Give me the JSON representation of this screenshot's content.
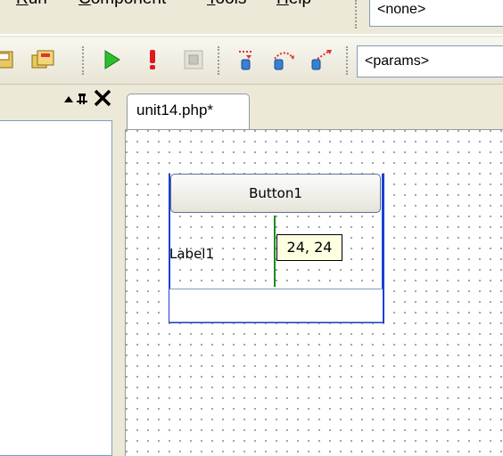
{
  "menu": {
    "items": [
      "Run",
      "Component",
      "Tools",
      "Help"
    ]
  },
  "toolbar": {
    "target_combo": "<none>",
    "params_combo": "<params>",
    "icons": [
      "save-icon",
      "save-all-icon",
      "run-icon",
      "debug-icon",
      "stop-icon",
      "step-into-icon",
      "step-over-icon",
      "step-out-icon"
    ]
  },
  "left_panel": {
    "pin_glyph": "▲ ⊓",
    "close_glyph": "✕"
  },
  "editor": {
    "tab_label": "unit14.php*"
  },
  "form": {
    "button_caption": "Button1",
    "label_caption": "Label1",
    "coordinate_tooltip": "24, 24"
  },
  "colors": {
    "selection": "#1A3FD8",
    "guide": "#1E8A1E",
    "tooltip_bg": "#FFFFE1"
  }
}
